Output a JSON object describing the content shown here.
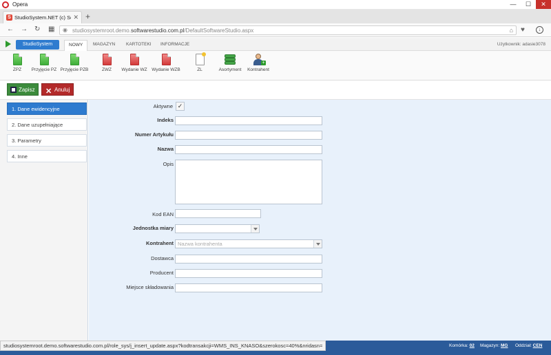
{
  "browser": {
    "app_name": "Opera",
    "tab_title": "StudioSystem.NET (c) Soft",
    "url_host": "studiosystemroot.demo.",
    "url_domain": "softwarestudio.com.pl",
    "url_path": "/DefaultSoftwareStudio.aspx",
    "status_url": "studiosystemroot.demo.softwarestudio.com.pl/role_sys/j_insert_update.aspx?kodtransakcji=WMS_INS_KNASO&szerokosc=40%&nridasn="
  },
  "app": {
    "brand_label": "StudioSystem",
    "menu": [
      "NOWY",
      "MAGAZYN",
      "KARTOTEKI",
      "INFORMACJE"
    ],
    "user_label": "Użytkownik: adasie3078"
  },
  "ribbon": {
    "items": [
      "ZPZ",
      "Przyjęcie PZ",
      "Przyjęcie PZB",
      "ZWZ",
      "Wydanie WZ",
      "Wydanie WZB",
      "ZL",
      "Asortyment",
      "Kontrahent"
    ]
  },
  "actions": {
    "save_label": "Zapisz",
    "cancel_label": "Anuluj"
  },
  "leftnav": {
    "items": [
      "1. Dane ewidencyjne",
      "2. Dane uzupełniające",
      "3. Parametry",
      "4. Inne"
    ]
  },
  "form": {
    "aktywne_label": "Aktywne",
    "aktywne_check": "✓",
    "indeks_label": "Indeks",
    "numer_label": "Numer Artykułu",
    "nazwa_label": "Nazwa",
    "opis_label": "Opis",
    "ean_label": "Kod EAN",
    "jm_label": "Jednostka miary",
    "kontrahent_label": "Kontrahent",
    "kontrahent_placeholder": "Nazwa kontrahenta",
    "dostawca_label": "Dostawca",
    "producent_label": "Producent",
    "miejsce_label": "Miejsce składowania"
  },
  "status": {
    "komorka_label": "Komórka:",
    "komorka_value": "02",
    "magazyn_label": "Magazyn:",
    "magazyn_value": "MG",
    "oddzial_label": "Oddział:",
    "oddzial_value": "CEN"
  },
  "colors": {
    "accent": "#2e7bcf",
    "save": "#3c8b3c",
    "cancel": "#b32a2a",
    "form_bg": "#e8f1fb"
  }
}
